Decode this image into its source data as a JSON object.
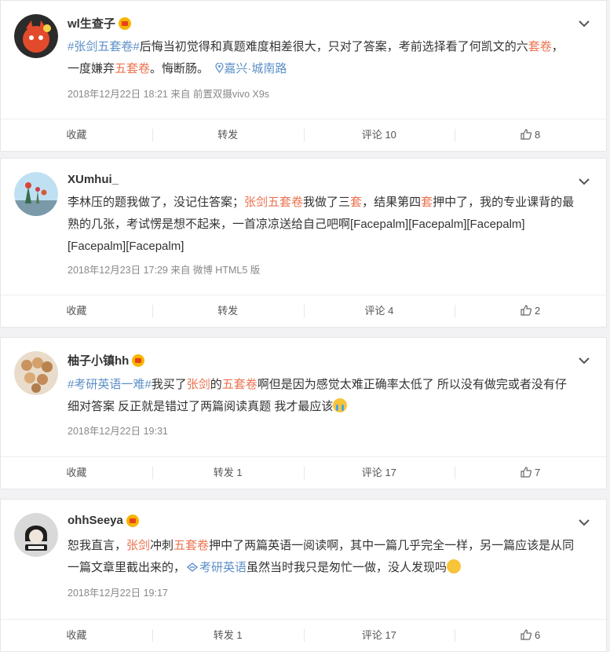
{
  "posts": [
    {
      "user": "wl生查子",
      "text_segments": [
        {
          "t": "#张剑五套卷#",
          "k": "tag"
        },
        {
          "t": "后悔当初觉得和真题难度相差很大，只对了答案，考前选择看了何凯文的六",
          "k": "n"
        },
        {
          "t": "套卷",
          "k": "hl"
        },
        {
          "t": "，一度嫌弃",
          "k": "n"
        },
        {
          "t": "五套卷",
          "k": "hl"
        },
        {
          "t": "。悔断肠。",
          "k": "n"
        }
      ],
      "location": "嘉兴·城南路",
      "meta": "2018年12月22日 18:21  来自 前置双摄vivo X9s",
      "actions": {
        "collect": "收藏",
        "repost": "转发",
        "comment": "评论 10",
        "like": "8"
      }
    },
    {
      "user": "XUmhui_",
      "text_segments": [
        {
          "t": "李林压的题我做了，没记住答案；",
          "k": "n"
        },
        {
          "t": "张剑五套卷",
          "k": "hl"
        },
        {
          "t": "我做了三",
          "k": "n"
        },
        {
          "t": "套",
          "k": "hl"
        },
        {
          "t": "，结果第四",
          "k": "n"
        },
        {
          "t": "套",
          "k": "hl"
        },
        {
          "t": "押中了，我的专业课背的最熟的几张，考试愣是想不起来，一首凉凉送给自己吧啊[Facepalm][Facepalm][Facepalm][Facepalm][Facepalm]",
          "k": "n"
        }
      ],
      "meta": "2018年12月23日 17:29  来自 微博 HTML5 版",
      "actions": {
        "collect": "收藏",
        "repost": "转发",
        "comment": "评论 4",
        "like": "2"
      }
    },
    {
      "user": "柚子小镇hh",
      "text_segments": [
        {
          "t": "#考研英语一难#",
          "k": "tag"
        },
        {
          "t": "我买了",
          "k": "n"
        },
        {
          "t": "张剑",
          "k": "hl"
        },
        {
          "t": "的",
          "k": "n"
        },
        {
          "t": "五套卷",
          "k": "hl"
        },
        {
          "t": "啊但是因为感觉太难正确率太低了 所以没有做完或者没有仔细对答案 反正就是错过了两篇阅读真题 我才最应该",
          "k": "n"
        }
      ],
      "meta": "2018年12月22日 19:31",
      "actions": {
        "collect": "收藏",
        "repost": "转发 1",
        "comment": "评论 17",
        "like": "7"
      }
    },
    {
      "user": "ohhSeeya",
      "text_segments": [
        {
          "t": "恕我直言，",
          "k": "n"
        },
        {
          "t": "张剑",
          "k": "hl"
        },
        {
          "t": "冲刺",
          "k": "n"
        },
        {
          "t": "五套卷",
          "k": "hl"
        },
        {
          "t": "押中了两篇英语一阅读啊，其中一篇几乎完全一样，另一篇应该是从同一篇文章里截出来的，",
          "k": "n"
        },
        {
          "t": "考研英语",
          "k": "tag"
        },
        {
          "t": "虽然当时我只是匆忙一做，没人发现吗",
          "k": "n"
        }
      ],
      "meta": "2018年12月22日 19:17",
      "actions": {
        "collect": "收藏",
        "repost": "转发 1",
        "comment": "评论 17",
        "like": "6"
      }
    }
  ]
}
